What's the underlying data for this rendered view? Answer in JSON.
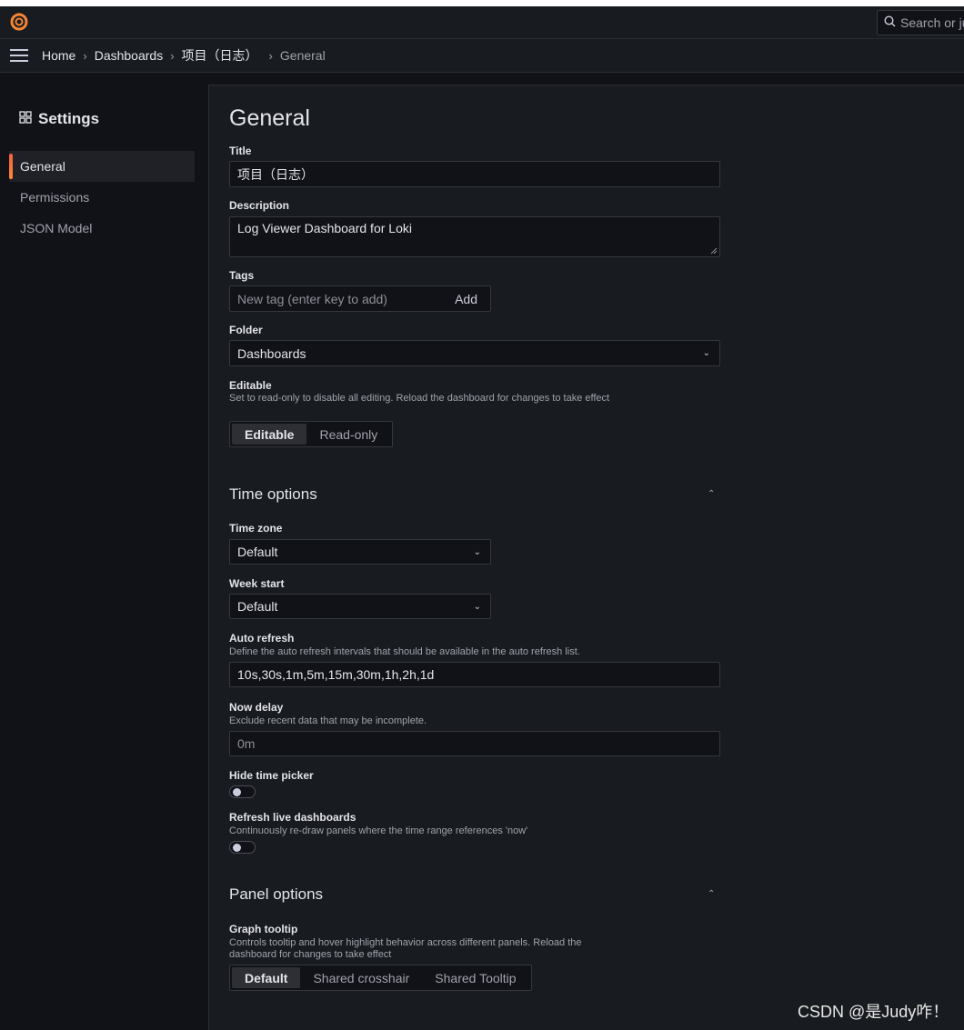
{
  "topbar": {
    "search_placeholder": "Search or ju"
  },
  "breadcrumb": [
    "Home",
    "Dashboards",
    "项目（日志）",
    "General"
  ],
  "sidebar": {
    "title": "Settings",
    "items": [
      {
        "label": "General",
        "active": true
      },
      {
        "label": "Permissions",
        "active": false
      },
      {
        "label": "JSON Model",
        "active": false
      }
    ]
  },
  "general": {
    "heading": "General",
    "title_label": "Title",
    "title_value": "项目（日志）",
    "description_label": "Description",
    "description_value": "Log Viewer Dashboard for Loki",
    "tags_label": "Tags",
    "tags_placeholder": "New tag (enter key to add)",
    "tags_add": "Add",
    "folder_label": "Folder",
    "folder_value": "Dashboards",
    "editable_label": "Editable",
    "editable_desc": "Set to read-only to disable all editing. Reload the dashboard for changes to take effect",
    "editable_options": [
      "Editable",
      "Read-only"
    ]
  },
  "time_options": {
    "heading": "Time options",
    "timezone_label": "Time zone",
    "timezone_value": "Default",
    "weekstart_label": "Week start",
    "weekstart_value": "Default",
    "autorefresh_label": "Auto refresh",
    "autorefresh_desc": "Define the auto refresh intervals that should be available in the auto refresh list.",
    "autorefresh_value": "10s,30s,1m,5m,15m,30m,1h,2h,1d",
    "nowdelay_label": "Now delay",
    "nowdelay_desc": "Exclude recent data that may be incomplete.",
    "nowdelay_placeholder": "0m",
    "hidepicker_label": "Hide time picker",
    "refreshlive_label": "Refresh live dashboards",
    "refreshlive_desc": "Continuously re-draw panels where the time range references 'now'"
  },
  "panel_options": {
    "heading": "Panel options",
    "tooltip_label": "Graph tooltip",
    "tooltip_desc": "Controls tooltip and hover highlight behavior across different panels. Reload the dashboard for changes to take effect",
    "tooltip_options": [
      "Default",
      "Shared crosshair",
      "Shared Tooltip"
    ]
  },
  "watermark": "CSDN @是Judy咋！",
  "colors": {
    "accent": "#f55f3e",
    "background": "#111217",
    "panel": "#181b1f"
  }
}
